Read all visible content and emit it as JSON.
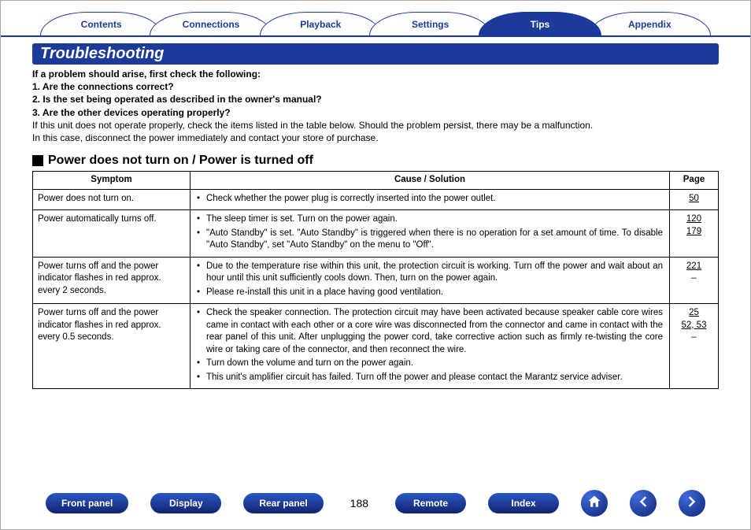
{
  "tabs": {
    "items": [
      {
        "label": "Contents",
        "active": false
      },
      {
        "label": "Connections",
        "active": false
      },
      {
        "label": "Playback",
        "active": false
      },
      {
        "label": "Settings",
        "active": false
      },
      {
        "label": "Tips",
        "active": true
      },
      {
        "label": "Appendix",
        "active": false
      }
    ]
  },
  "section_title": "Troubleshooting",
  "intro": {
    "lead": "If a problem should arise, first check the following:",
    "checks": [
      "1. Are the connections correct?",
      "2. Is the set being operated as described in the owner's manual?",
      "3. Are the other devices operating properly?"
    ],
    "para1": "If this unit does not operate properly, check the items listed in the table below. Should the problem persist, there may be a malfunction.",
    "para2": "In this case, disconnect the power immediately and contact your store of purchase."
  },
  "subheading": "Power does not turn on / Power is turned off",
  "table": {
    "headers": {
      "symptom": "Symptom",
      "cause": "Cause / Solution",
      "page": "Page"
    },
    "rows": [
      {
        "symptom": "Power does not turn on.",
        "causes": [
          {
            "text": "Check whether the power plug is correctly inserted into the power outlet.",
            "page": "50"
          }
        ]
      },
      {
        "symptom": "Power automatically turns off.",
        "causes": [
          {
            "text": "The sleep timer is set. Turn on the power again.",
            "page": "120"
          },
          {
            "text": "\"Auto Standby\" is set. \"Auto Standby\" is triggered when there is no operation for a set amount of time. To disable \"Auto Standby\", set \"Auto Standby\" on the menu to \"Off\".",
            "page": "179"
          }
        ]
      },
      {
        "symptom": "Power turns off and the power indicator flashes in red approx. every 2 seconds.",
        "causes": [
          {
            "text": "Due to the temperature rise within this unit, the protection circuit is working. Turn off the power and wait about an hour until this unit sufficiently cools down. Then, turn on the power again.",
            "page": "221"
          },
          {
            "text": "Please re-install this unit in a place having good ventilation.",
            "page": "–"
          }
        ]
      },
      {
        "symptom": "Power turns off and the power indicator flashes in red approx. every 0.5 seconds.",
        "causes": [
          {
            "text": "Check the speaker connection. The protection circuit may have been activated because speaker cable core wires came in contact with each other or a core wire was disconnected from the connector and came in contact with the rear panel of this unit. After unplugging the power cord, take corrective action such as firmly re-twisting the core wire or taking care of the connector, and then reconnect the wire.",
            "page": "25"
          },
          {
            "text": "Turn down the volume and turn on the power again.",
            "page": "52, 53"
          },
          {
            "text": "This unit's amplifier circuit has failed. Turn off the power and please contact the Marantz service adviser.",
            "page": "–"
          }
        ]
      }
    ]
  },
  "footer": {
    "buttons": {
      "front_panel": "Front panel",
      "display": "Display",
      "rear_panel": "Rear panel",
      "remote": "Remote",
      "index": "Index"
    },
    "page_number": "188"
  }
}
